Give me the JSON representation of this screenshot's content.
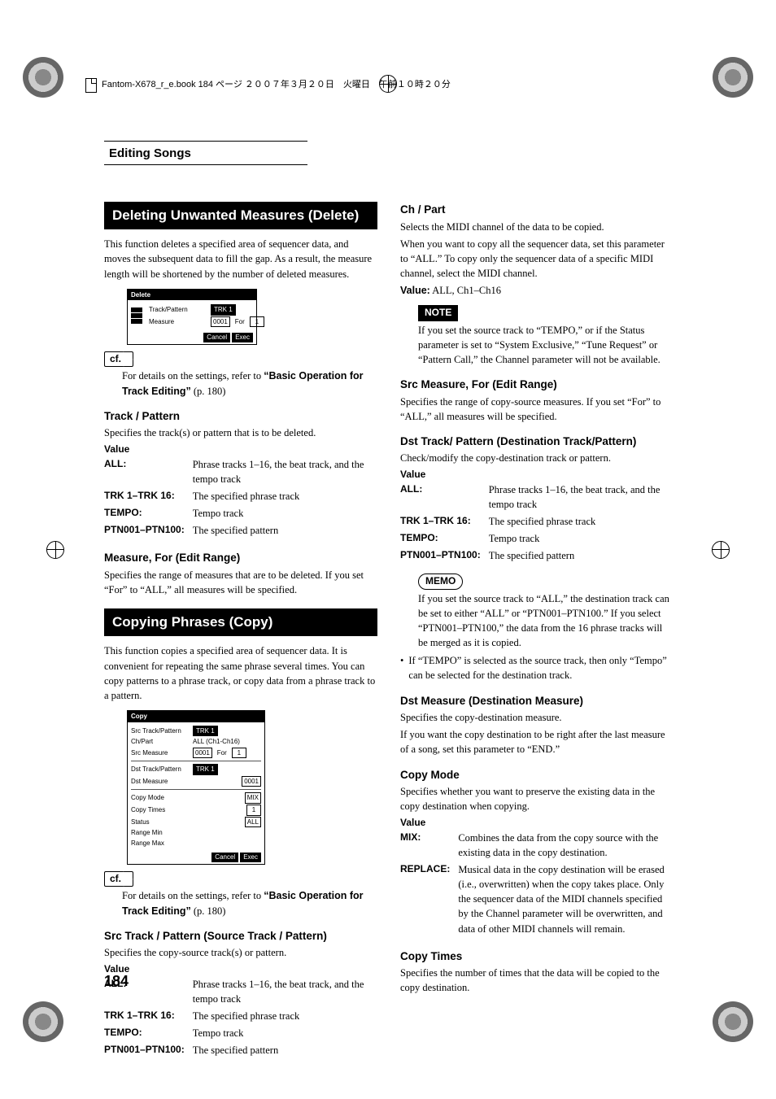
{
  "book_header": "Fantom-X678_r_e.book 184 ページ ２００７年３月２０日　火曜日　午前１０時２０分",
  "running_head": "Editing Songs",
  "page_number": "184",
  "left": {
    "h1": "Deleting Unwanted Measures (Delete)",
    "p1": "This function deletes a specified area of sequencer data, and moves the subsequent data to fill the gap. As a result, the measure length will be shortened by the number of deleted measures.",
    "ui_delete": {
      "title": "Delete",
      "row1_label": "Track/Pattern",
      "row1_val": "TRK 1",
      "row2_label": "Measure",
      "row2_val1": "0001",
      "row2_for": "For",
      "row2_val2": "1",
      "cancel": "Cancel",
      "exec": "Exec"
    },
    "cf_label": "cf.",
    "cf1": "For details on the settings, refer to ",
    "cf1_ref": "“Basic Operation for Track Editing”",
    "cf1_tail": " (p. 180)",
    "h_track": "Track / Pattern",
    "p_track": "Specifies the track(s) or pattern that is to be deleted.",
    "value_label": "Value",
    "vals1": {
      "ALL": "Phrase tracks 1–16, the beat track, and the tempo track",
      "TRK1": "The specified phrase track",
      "TEMPO": "Tempo track",
      "PTN": "The specified pattern"
    },
    "keys": {
      "ALL": "ALL:",
      "TRK1": "TRK 1–TRK 16:",
      "TEMPO": "TEMPO:",
      "PTN": "PTN001–PTN100:"
    },
    "h_meas": "Measure, For (Edit Range)",
    "p_meas": "Specifies the range of measures that are to be deleted. If you set “For” to “ALL,” all measures will be specified.",
    "h2": "Copying Phrases (Copy)",
    "p2": "This function copies a specified area of sequencer data. It is convenient for repeating the same phrase several times. You can copy patterns to a phrase track, or copy data from a phrase track to a pattern.",
    "ui_copy": {
      "title": "Copy",
      "rows": {
        "src_tp": "Src Track/Pattern",
        "src_tp_v": "TRK 1",
        "chpart": "Ch/Part",
        "chpart_v": "ALL (Ch1-Ch16)",
        "src_meas": "Src Measure",
        "src_meas_v1": "0001",
        "for": "For",
        "src_meas_v2": "1",
        "dst_tp": "Dst Track/Pattern",
        "dst_tp_v": "TRK 1",
        "dst_meas": "Dst Measure",
        "dst_meas_v": "0001",
        "copy_mode": "Copy Mode",
        "copy_mode_v": "MIX",
        "copy_times": "Copy Times",
        "copy_times_v": "1",
        "status": "Status",
        "status_v": "ALL",
        "rmin": "Range Min",
        "rmax": "Range Max"
      },
      "cancel": "Cancel",
      "exec": "Exec"
    },
    "cf2": "For details on the settings, refer to ",
    "cf2_ref": "“Basic Operation for Track Editing”",
    "cf2_tail": " (p. 180)",
    "h_srctp": "Src Track / Pattern (Source Track / Pattern)",
    "p_srctp": "Specifies the copy-source track(s) or pattern."
  },
  "right": {
    "h_ch": "Ch / Part",
    "p_ch1": "Selects the MIDI channel of the data to be copied.",
    "p_ch2": "When you want to copy all the sequencer data, set this parameter to “ALL.” To copy only the sequencer data of a specific MIDI channel, select the MIDI channel.",
    "p_ch_val_label": "Value:",
    "p_ch_val": " ALL, Ch1–Ch16",
    "note_label": "NOTE",
    "note_text": "If you set the source track to “TEMPO,” or if the Status parameter is set to “System Exclusive,” “Tune Request” or “Pattern Call,” the Channel parameter will not be available.",
    "h_srcmeas": "Src Measure, For (Edit Range)",
    "p_srcmeas": "Specifies the range of copy-source measures. If you set “For” to “ALL,” all measures will be specified.",
    "h_dsttp": "Dst Track/ Pattern (Destination Track/Pattern)",
    "p_dsttp": "Check/modify the copy-destination track or pattern.",
    "memo_label": "MEMO",
    "memo_text": "If you set the source track to “ALL,” the destination track can be set to either “ALL” or “PTN001–PTN100.” If you select “PTN001–PTN100,” the data from the 16 phrase tracks will be merged as it is copied.",
    "bullet": "If “TEMPO” is selected as the source track, then only “Tempo” can be selected for the destination track.",
    "h_dstmeas": "Dst Measure (Destination Measure)",
    "p_dstmeas1": "Specifies the copy-destination measure.",
    "p_dstmeas2": "If you want the copy destination to be right after the last measure of a song, set this parameter to “END.”",
    "h_cmode": "Copy Mode",
    "p_cmode": "Specifies whether you want to preserve the existing data in the copy destination when copying.",
    "mode_keys": {
      "MIX": "MIX:",
      "REPLACE": "REPLACE:"
    },
    "mode_vals": {
      "MIX": "Combines the data from the copy source with the existing data in the copy destination.",
      "REPLACE": "Musical data in the copy destination will be erased (i.e., overwritten) when the copy takes place. Only the sequencer data of the MIDI channels specified by the Channel parameter will be overwritten, and data of other MIDI channels will remain."
    },
    "h_ctimes": "Copy Times",
    "p_ctimes": "Specifies the number of times that the data will be copied to the copy destination."
  }
}
